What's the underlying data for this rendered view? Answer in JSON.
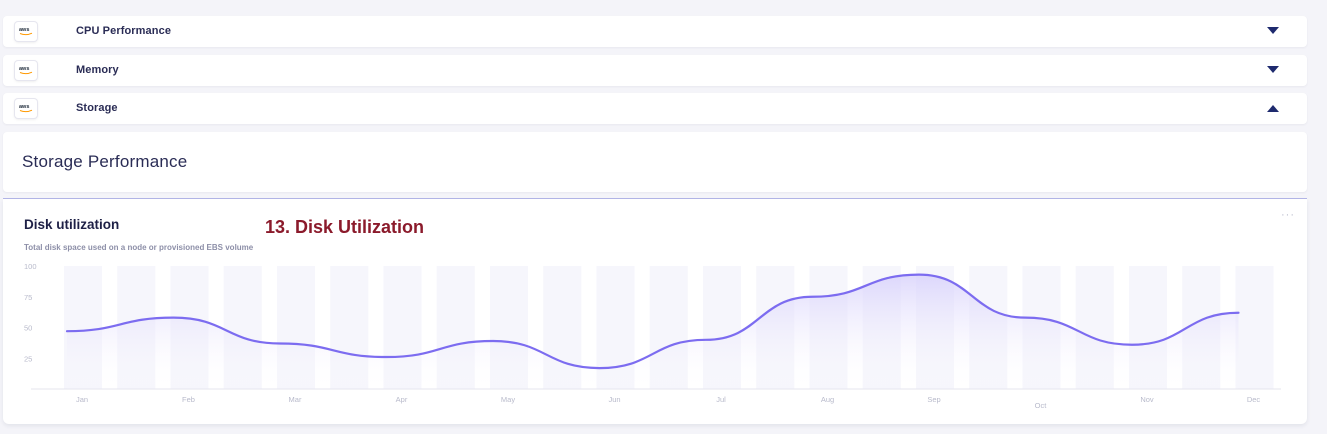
{
  "accordion": [
    {
      "label": "CPU Performance",
      "logo": "aws",
      "state": "collapsed"
    },
    {
      "label": "Memory",
      "logo": "aws",
      "state": "collapsed"
    },
    {
      "label": "Storage",
      "logo": "aws",
      "state": "expanded"
    }
  ],
  "section": {
    "title": "Storage Performance"
  },
  "card": {
    "title": "Disk utilization",
    "subtitle": "Total disk space used on a node or provisioned EBS volume",
    "annotation": "13. Disk Utilization",
    "menu_icon": "ellipsis-icon"
  },
  "colors": {
    "line": "#7c6cf0",
    "area_top": "#d4cdfb",
    "column": "#f6f6fc",
    "accent_text": "#8b1a2b",
    "divider": "#b3b6e8"
  },
  "chart_data": {
    "type": "area",
    "categories": [
      "Jan",
      "Feb",
      "Mar",
      "Apr",
      "May",
      "Jun",
      "Jul",
      "Aug",
      "Sep",
      "Oct",
      "Nov",
      "Dec"
    ],
    "series": [
      {
        "values": [
          47,
          58,
          37,
          26,
          39,
          17,
          40,
          75,
          93,
          58,
          36,
          62
        ]
      }
    ],
    "y_ticks": [
      100,
      75,
      50,
      25
    ],
    "ylim": [
      0,
      100
    ],
    "grid": false,
    "smooth": true,
    "background_columns": true
  }
}
